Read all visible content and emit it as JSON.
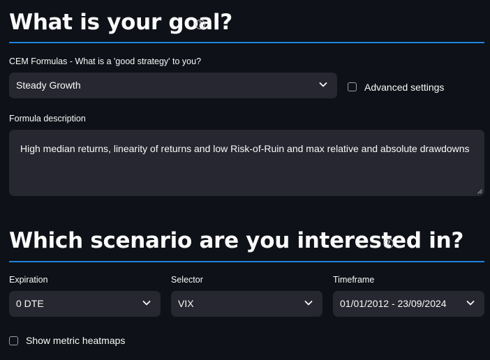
{
  "goal": {
    "heading": "What is your goal?",
    "help_glyph": "?",
    "formula_label": "CEM Formulas - What is a 'good strategy' to you?",
    "formula_value": "Steady Growth",
    "advanced_label": "Advanced settings",
    "description_label": "Formula description",
    "description_text": "High median returns, linearity of returns and low Risk-of-Ruin and max relative and absolute drawdowns"
  },
  "scenario": {
    "heading": "Which scenario are you interested in?",
    "help_glyph": "?",
    "expiration_label": "Expiration",
    "expiration_value": "0 DTE",
    "selector_label": "Selector",
    "selector_value": "VIX",
    "timeframe_label": "Timeframe",
    "timeframe_value": "01/01/2012 - 23/09/2024",
    "heatmaps_label": "Show metric heatmaps"
  },
  "colors": {
    "background": "#0e1117",
    "widget": "#262730",
    "accent": "#1c83e1",
    "text": "#fafafa"
  },
  "icons": [
    "help-circle-icon",
    "chevron-down-icon",
    "checkbox-icon",
    "resize-handle-icon"
  ]
}
